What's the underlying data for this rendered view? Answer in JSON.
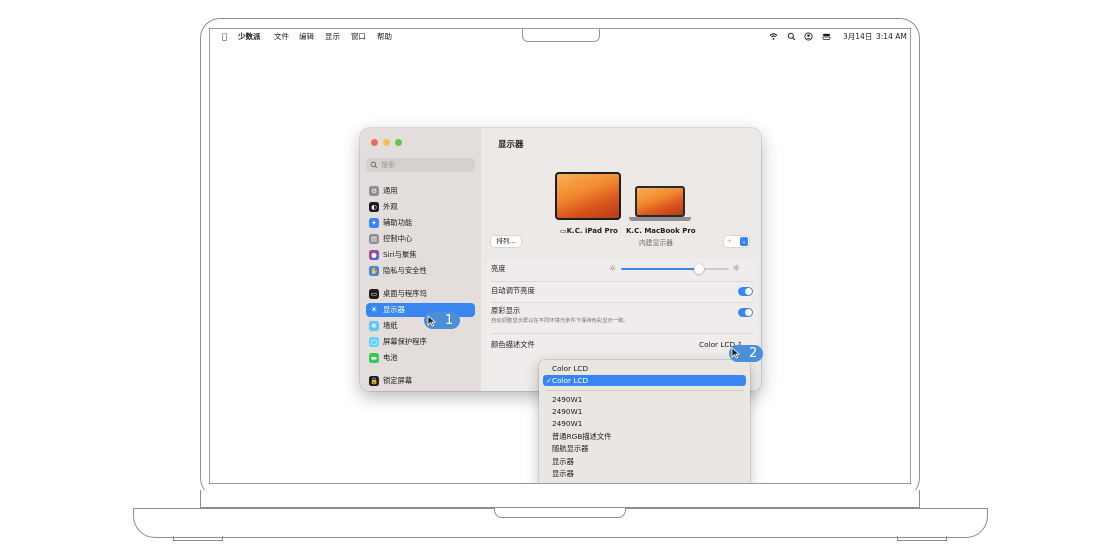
{
  "menubar": {
    "app_name": "少数派",
    "menus": [
      "文件",
      "编辑",
      "显示",
      "窗口",
      "帮助"
    ],
    "date": "3月14日",
    "time": "3:14 AM"
  },
  "sidebar": {
    "search_placeholder": "搜索",
    "items": [
      {
        "label": "通用",
        "icon": "gear-icon",
        "color": "#8e8e93"
      },
      {
        "label": "外观",
        "icon": "appearance-icon",
        "color": "#1d1d1f"
      },
      {
        "label": "辅助功能",
        "icon": "accessibility-icon",
        "color": "#3a86f0"
      },
      {
        "label": "控制中心",
        "icon": "control-center-icon",
        "color": "#8e8e93"
      },
      {
        "label": "Siri与聚焦",
        "icon": "siri-icon",
        "color": "#c2417f"
      },
      {
        "label": "隐私与安全性",
        "icon": "hand-icon",
        "color": "#3a86f0"
      },
      {
        "label": "桌面与程序坞",
        "icon": "dock-icon",
        "color": "#1d1d1f"
      },
      {
        "label": "显示器",
        "icon": "sun-icon",
        "color": "#3a86f0"
      },
      {
        "label": "墙纸",
        "icon": "wallpaper-icon",
        "color": "#5ac8fa"
      },
      {
        "label": "屏幕保护程序",
        "icon": "screensaver-icon",
        "color": "#64d2ff"
      },
      {
        "label": "电池",
        "icon": "battery-icon",
        "color": "#34c759"
      },
      {
        "label": "锁定屏幕",
        "icon": "lock-icon",
        "color": "#1d1d1f"
      }
    ]
  },
  "main": {
    "title": "显示器",
    "arrange_button": "排列...",
    "display_1": {
      "name": "K.C. iPad Pro"
    },
    "display_2": {
      "name": "K.C. MacBook Pro",
      "subtitle": "内建显示器"
    },
    "add_button": "+",
    "brightness_label": "亮度",
    "brightness_value": 0.72,
    "auto_brightness_label": "自动调节亮度",
    "true_tone_label": "原彩显示",
    "true_tone_desc": "自动调整显示屏以在不同环境光条件下保持色彩显示一致。",
    "color_profile_label": "颜色描述文件",
    "color_profile_value": "Color LCD"
  },
  "dropdown": {
    "items": [
      "Color LCD",
      "Color LCD",
      "2490W1",
      "2490W1",
      "2490W1",
      "普通RGB描述文件",
      "随航显示器",
      "显示器",
      "显示器"
    ],
    "selected_index": 1,
    "check": "✓"
  },
  "callouts": {
    "first": "1",
    "second": "2"
  },
  "colors": {
    "accent": "#3a86f0",
    "callout": "#4b8fd9"
  }
}
